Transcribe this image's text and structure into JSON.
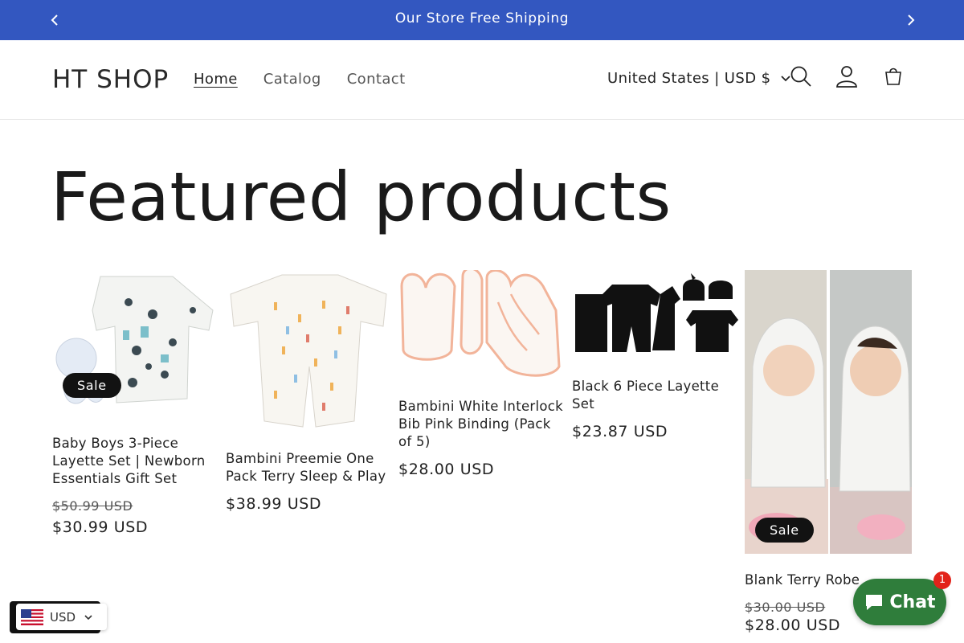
{
  "announcement": {
    "text": "Our Store Free Shipping",
    "prev_icon": "chevron-left-icon",
    "next_icon": "chevron-right-icon"
  },
  "header": {
    "logo": "HT SHOP",
    "nav": [
      {
        "label": "Home",
        "active": true
      },
      {
        "label": "Catalog"
      },
      {
        "label": "Contact"
      }
    ],
    "country_selector": "United States | USD $",
    "icons": [
      "search-icon",
      "account-icon",
      "cart-icon"
    ]
  },
  "section": {
    "title": "Featured products"
  },
  "products": [
    {
      "title": "Baby Boys 3-Piece Layette Set | Newborn Essentials Gift Set",
      "price_old": "$50.99 USD",
      "price": "$30.99 USD",
      "badge": "Sale"
    },
    {
      "title": "Bambini Preemie One Pack Terry Sleep & Play",
      "price": "$38.99 USD"
    },
    {
      "title": "Bambini White Interlock Bib Pink Binding (Pack of 5)",
      "price": "$28.00 USD"
    },
    {
      "title": "Black 6 Piece Layette Set",
      "price": "$23.87 USD"
    },
    {
      "title": "Blank Terry Robe",
      "price_old": "$30.00 USD",
      "price": "$28.00 USD",
      "badge": "Sale"
    }
  ],
  "currency_widget": {
    "label": "USD",
    "flag": "us-flag-icon"
  },
  "chat_widget": {
    "label": "Chat",
    "unread": "1"
  },
  "colors": {
    "announcement_bg": "#3357c0",
    "badge_bg": "#121212",
    "chat_bg": "#2f7d3b",
    "unread_badge": "#e2231a"
  }
}
